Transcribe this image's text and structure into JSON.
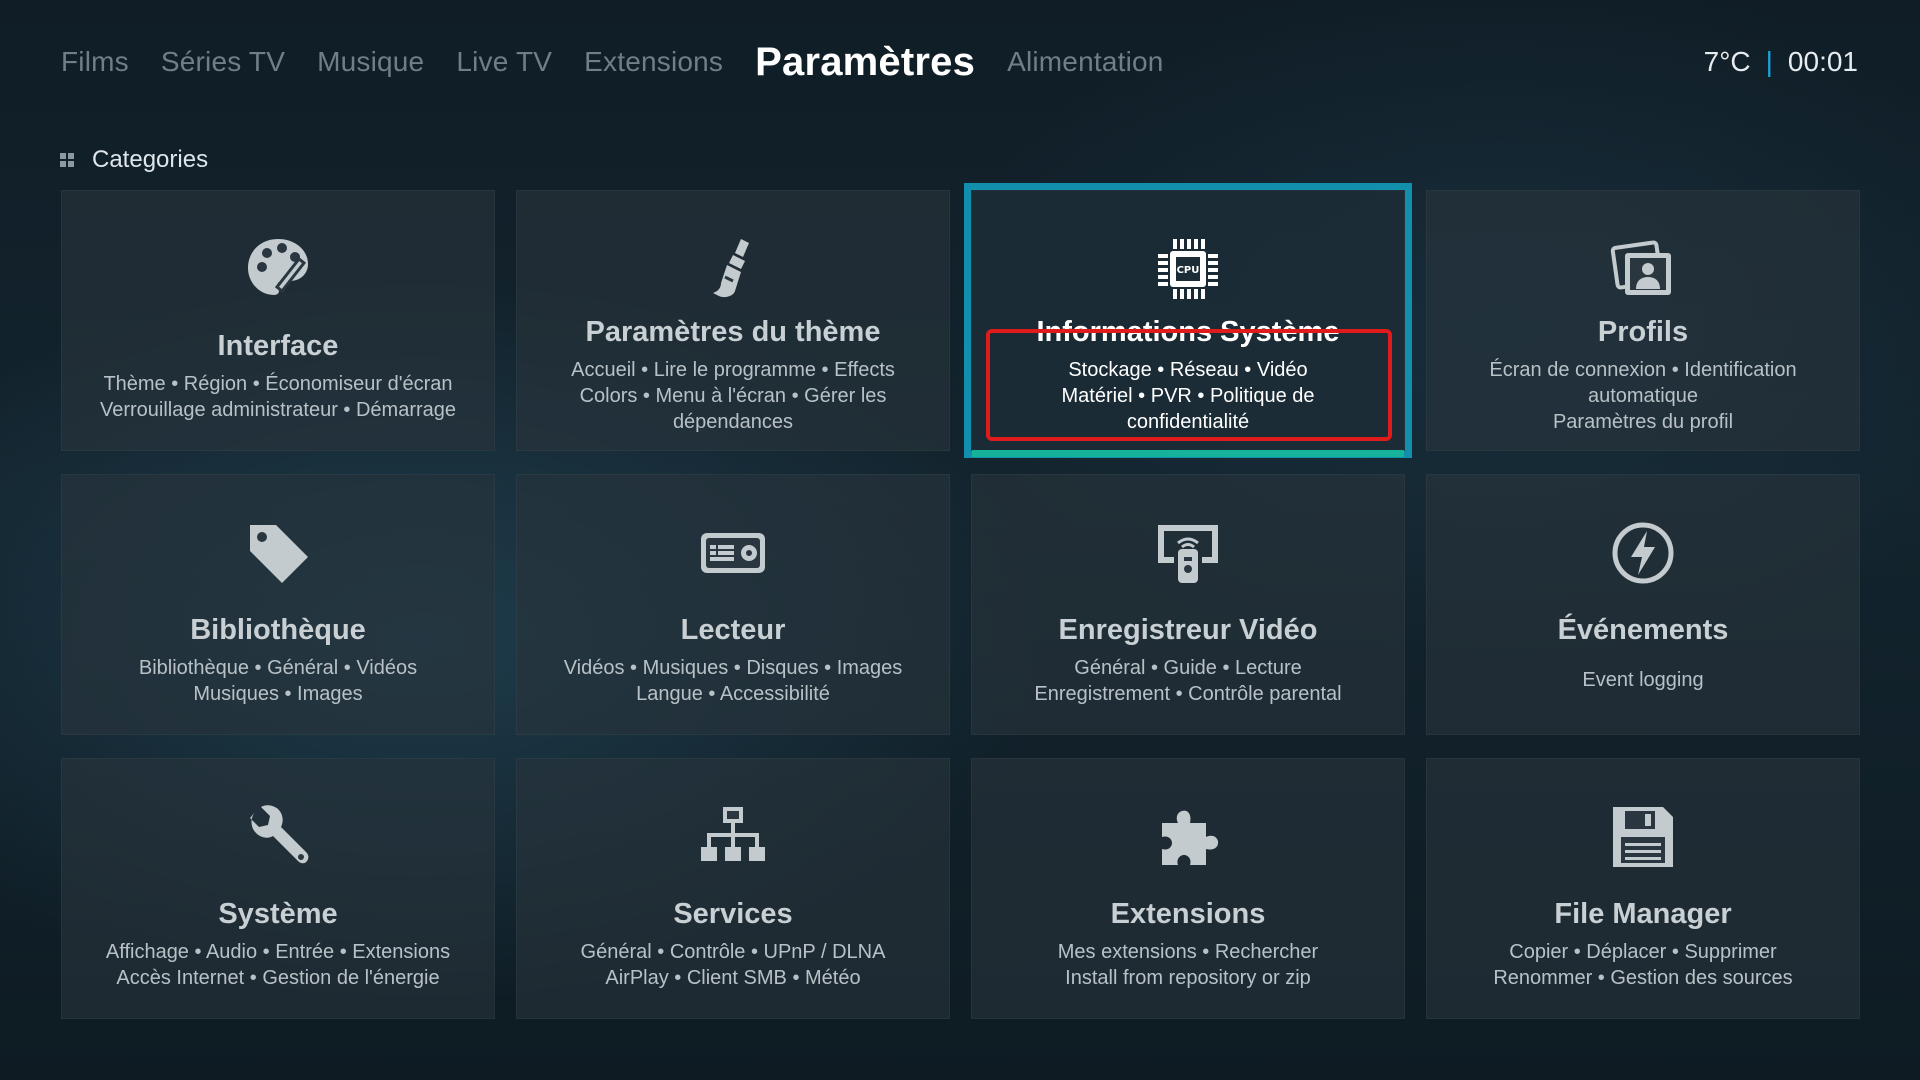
{
  "nav": {
    "items": [
      {
        "label": "Films"
      },
      {
        "label": "Séries TV"
      },
      {
        "label": "Musique"
      },
      {
        "label": "Live TV"
      },
      {
        "label": "Extensions"
      },
      {
        "label": "Paramètres",
        "active": true
      },
      {
        "label": "Alimentation"
      }
    ]
  },
  "status": {
    "temperature": "7°C",
    "time": "00:01",
    "separator": "|"
  },
  "categories": {
    "label": "Categories"
  },
  "tiles": [
    {
      "icon": "palette-icon",
      "title": "Interface",
      "desc_line1": "Thème • Région • Économiseur d'écran",
      "desc_line2": "Verrouillage administrateur • Démarrage"
    },
    {
      "icon": "paintbrush-icon",
      "title": "Paramètres du thème",
      "desc_line1": "Accueil • Lire le programme • Effects",
      "desc_line2": "Colors • Menu à l'écran • Gérer les",
      "desc_line3": "dépendances"
    },
    {
      "icon": "cpu-icon",
      "title": "Informations Système",
      "desc_line1": "Stockage • Réseau • Vidéo",
      "desc_line2": "Matériel • PVR • Politique de",
      "desc_line3": "confidentialité",
      "focused": true,
      "cpu_label": "CPU"
    },
    {
      "icon": "profile-photo-icon",
      "title": "Profils",
      "desc_line1": "Écran de connexion • Identification",
      "desc_line2": "automatique",
      "desc_line3": "Paramètres du profil"
    },
    {
      "icon": "tag-icon",
      "title": "Bibliothèque",
      "desc_line1": "Bibliothèque • Général • Vidéos",
      "desc_line2": "Musiques • Images"
    },
    {
      "icon": "player-icon",
      "title": "Lecteur",
      "desc_line1": "Vidéos • Musiques • Disques • Images",
      "desc_line2": "Langue • Accessibilité"
    },
    {
      "icon": "pvr-remote-icon",
      "title": "Enregistreur Vidéo",
      "desc_line1": "Général • Guide • Lecture",
      "desc_line2": "Enregistrement • Contrôle parental"
    },
    {
      "icon": "lightning-icon",
      "title": "Événements",
      "desc_line1": "Event logging"
    },
    {
      "icon": "wrench-icon",
      "title": "Système",
      "desc_line1": "Affichage • Audio • Entrée • Extensions",
      "desc_line2": "Accès Internet • Gestion de l'énergie"
    },
    {
      "icon": "network-icon",
      "title": "Services",
      "desc_line1": "Général • Contrôle • UPnP / DLNA",
      "desc_line2": "AirPlay • Client SMB • Météo"
    },
    {
      "icon": "puzzle-icon",
      "title": "Extensions",
      "desc_line1": "Mes extensions • Rechercher",
      "desc_line2": "Install from repository or zip"
    },
    {
      "icon": "floppy-icon",
      "title": "File Manager",
      "desc_line1": "Copier • Déplacer • Supprimer",
      "desc_line2": "Renommer • Gestion des sources"
    }
  ],
  "colors": {
    "focus_border": "#138fae",
    "focus_border_bottom": "#16b39b",
    "highlight_annotation": "#e01b1b",
    "status_separator": "#1ba3dd",
    "icon_gray": "#c4cbcf"
  }
}
